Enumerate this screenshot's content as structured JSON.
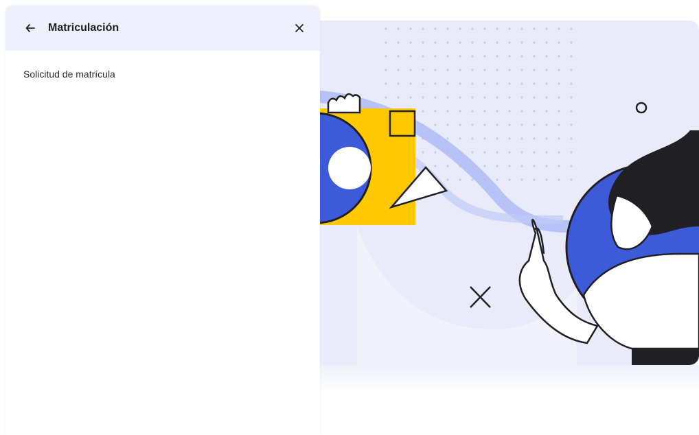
{
  "panel": {
    "title": "Matriculación",
    "back_icon": "arrow-left-icon",
    "close_icon": "close-icon",
    "items": [
      {
        "label": "Solicitud de matrícula"
      }
    ]
  },
  "illustration": {
    "subject": "woman-pointing-up",
    "colors": {
      "card_background": "#e9ebfb",
      "blue": "#3d5bd9",
      "yellow": "#ffc800",
      "wave": "#aebcf5",
      "outline": "#1f1f24"
    }
  }
}
